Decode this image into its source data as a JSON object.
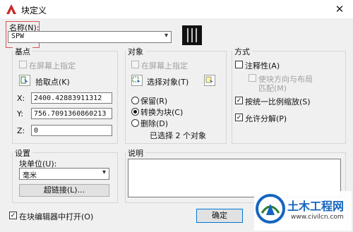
{
  "window": {
    "title": "块定义",
    "close_glyph": "✕"
  },
  "name": {
    "label": "名称(N):",
    "value": "SPW"
  },
  "base_point": {
    "group_title": "基点",
    "specify_on_screen": "在屏幕上指定",
    "pick_point": "拾取点(K)",
    "x_label": "X:",
    "x_value": "2400.42883911312",
    "y_label": "Y:",
    "y_value": "756.7091360860213",
    "z_label": "Z:",
    "z_value": "0"
  },
  "objects": {
    "group_title": "对象",
    "specify_on_screen": "在屏幕上指定",
    "select_objects": "选择对象(T)",
    "retain": "保留(R)",
    "convert_to_block": "转换为块(C)",
    "delete": "删除(D)",
    "selected_count": "已选择 2 个对象"
  },
  "behavior": {
    "group_title": "方式",
    "annotative": "注释性(A)",
    "match_orientation": "使块方向与布局",
    "match_orientation_2": "匹配(M)",
    "scale_uniformly": "按统一比例缩放(S)",
    "allow_exploding": "允许分解(P)",
    "annotative_checked": false,
    "scale_uniformly_checked": true,
    "allow_exploding_checked": true
  },
  "settings": {
    "group_title": "设置",
    "block_unit_label": "块单位(U):",
    "block_unit_value": "毫米",
    "hyperlink_button": "超链接(L)..."
  },
  "description": {
    "group_title": "说明",
    "value": ""
  },
  "footer": {
    "open_in_editor": "在块编辑器中打开(O)",
    "open_in_editor_checked": true,
    "ok_button": "确定"
  },
  "watermark": {
    "text": "土木工程网",
    "url": "www.civilcn.com"
  },
  "colors": {
    "highlight_box": "#d9534f",
    "accent_blue": "#1f5fae",
    "watermark_blue": "#1565c0"
  }
}
